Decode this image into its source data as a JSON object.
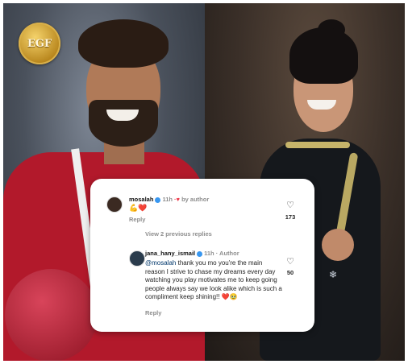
{
  "badge": {
    "text": "EGF"
  },
  "comment_main": {
    "username": "mosalah",
    "time": "11h",
    "author_tag": "by author",
    "text_emoji": "💪❤️",
    "reply_label": "Reply",
    "like_count": "173"
  },
  "view_replies_label": "View 2 previous replies",
  "comment_reply": {
    "username": "jana_hany_ismail",
    "time": "11h",
    "author_tag": "Author",
    "mention": "@mosalah",
    "text": "thank you mo you're the main reason I strive to chase my dreams every day watching you play motivates me to keep going people always say we look alike which is such a compliment keep shining!! ❤️🥹",
    "reply_label": "Reply",
    "like_count": "50"
  },
  "icons": {
    "like": "heart-outline-icon",
    "verified": "verified-badge-icon",
    "heart_filled": "heart-filled-icon"
  },
  "colors": {
    "shirt": "#b2192b",
    "verified": "#3897f0",
    "heart": "#ed3a4b",
    "mention": "#00376b"
  }
}
